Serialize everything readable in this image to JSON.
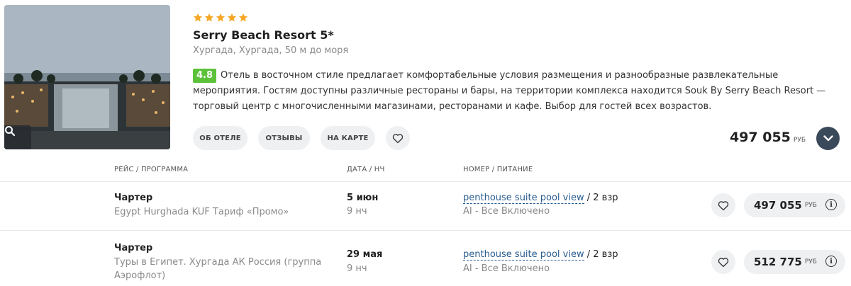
{
  "hotel": {
    "stars": 5,
    "name": "Serry Beach Resort 5*",
    "location": "Хургада, Хургада, 50 м до моря",
    "rating": "4.8",
    "description": "Отель в восточном стиле предлагает комфортабельные условия размещения и разнообразные развлекательные мероприятия. Гостям доступны различные рестораны и бары, на территории комплекса находится Souk By Serry Beach Resort — торговый центр с многочисленными магазинами, ресторанами и кафе. Выбор для гостей всех возрастов.",
    "photo_icon": "search-icon"
  },
  "actions": {
    "about": "ОБ ОТЕЛЕ",
    "reviews": "ОТЗЫВЫ",
    "map": "НА КАРТЕ",
    "favorite_icon": "heart-icon"
  },
  "price": {
    "amount": "497 055",
    "currency": "РУБ",
    "toggle_icon": "chevron-down-icon"
  },
  "table": {
    "headers": {
      "flight": "РЕЙС / ПРОГРАММА",
      "date": "ДАТА / НЧ",
      "room": "НОМЕР / ПИТАНИЕ"
    },
    "rows": [
      {
        "type": "Чартер",
        "program": "Egypt Hurghada KUF Тариф «Промо»",
        "date": "5 июн",
        "nights": "9 нч",
        "room": "penthouse suite pool view",
        "guests": " / 2 взр",
        "meal": "AI - Все Включено",
        "price": "497 055",
        "currency": "РУБ",
        "info": "i"
      },
      {
        "type": "Чартер",
        "program": "Туры в Египет. Хургада АК Россия (группа Аэрофлот)",
        "date": "29 мая",
        "nights": "9 нч",
        "room": "penthouse suite pool view",
        "guests": " / 2 взр",
        "meal": "AI - Все Включено",
        "price": "512 775",
        "currency": "РУБ",
        "info": "i"
      }
    ]
  },
  "colors": {
    "star": "#f5a623",
    "rating_bg": "#5cc23a",
    "link": "#2a5d8f",
    "toggle_bg": "#3b4a5a"
  }
}
